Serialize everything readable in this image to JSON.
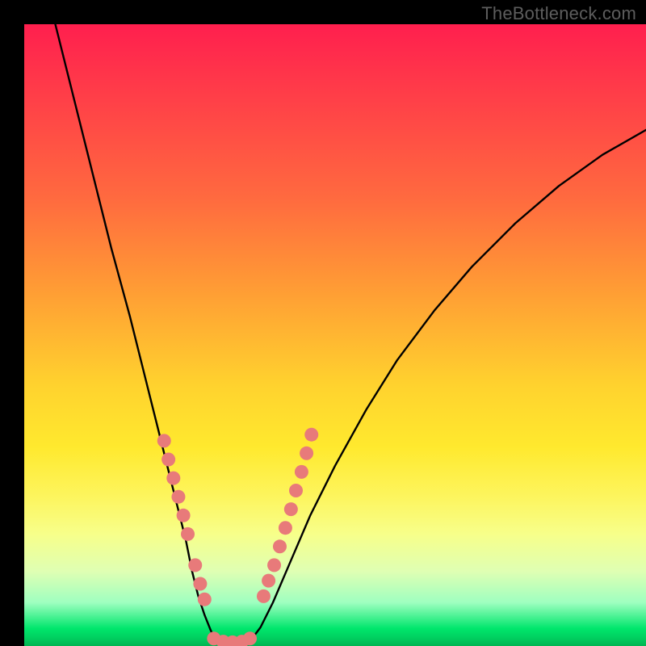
{
  "watermark": "TheBottleneck.com",
  "chart_data": {
    "type": "line",
    "title": "",
    "xlabel": "",
    "ylabel": "",
    "xlim": [
      0,
      100
    ],
    "ylim": [
      0,
      100
    ],
    "grid": false,
    "background": "rainbow-vertical-gradient",
    "series": [
      {
        "name": "left-curve",
        "x": [
          5,
          8,
          11,
          14,
          17,
          19,
          21,
          23,
          24.5,
          26,
          27,
          28,
          29,
          30,
          30.8
        ],
        "y": [
          100,
          88,
          76,
          64,
          53,
          45,
          37,
          29,
          23,
          17,
          12,
          8,
          5,
          2.5,
          1
        ],
        "stroke": "#000000"
      },
      {
        "name": "valley-flat",
        "x": [
          30.8,
          32,
          33.5,
          35,
          36.5
        ],
        "y": [
          1,
          0.6,
          0.5,
          0.6,
          1
        ],
        "stroke": "#000000"
      },
      {
        "name": "right-curve",
        "x": [
          36.5,
          38,
          40,
          43,
          46,
          50,
          55,
          60,
          66,
          72,
          79,
          86,
          93,
          100
        ],
        "y": [
          1,
          3,
          7,
          14,
          21,
          29,
          38,
          46,
          54,
          61,
          68,
          74,
          79,
          83
        ],
        "stroke": "#000000"
      }
    ],
    "markers": [
      {
        "name": "left-dot-cluster",
        "color": "#e87a7a",
        "points": [
          {
            "x": 22.5,
            "y": 33
          },
          {
            "x": 23.2,
            "y": 30
          },
          {
            "x": 24.0,
            "y": 27
          },
          {
            "x": 24.8,
            "y": 24
          },
          {
            "x": 25.6,
            "y": 21
          },
          {
            "x": 26.3,
            "y": 18
          },
          {
            "x": 27.5,
            "y": 13
          },
          {
            "x": 28.3,
            "y": 10
          },
          {
            "x": 29.0,
            "y": 7.5
          }
        ]
      },
      {
        "name": "right-dot-cluster",
        "color": "#e87a7a",
        "points": [
          {
            "x": 38.5,
            "y": 8
          },
          {
            "x": 39.3,
            "y": 10.5
          },
          {
            "x": 40.2,
            "y": 13
          },
          {
            "x": 41.1,
            "y": 16
          },
          {
            "x": 42.0,
            "y": 19
          },
          {
            "x": 42.9,
            "y": 22
          },
          {
            "x": 43.7,
            "y": 25
          },
          {
            "x": 44.6,
            "y": 28
          },
          {
            "x": 45.4,
            "y": 31
          },
          {
            "x": 46.2,
            "y": 34
          }
        ]
      },
      {
        "name": "bottom-dot-cluster",
        "color": "#e87a7a",
        "points": [
          {
            "x": 30.5,
            "y": 1.2
          },
          {
            "x": 32.0,
            "y": 0.7
          },
          {
            "x": 33.5,
            "y": 0.6
          },
          {
            "x": 35.0,
            "y": 0.7
          },
          {
            "x": 36.3,
            "y": 1.2
          }
        ]
      }
    ]
  }
}
